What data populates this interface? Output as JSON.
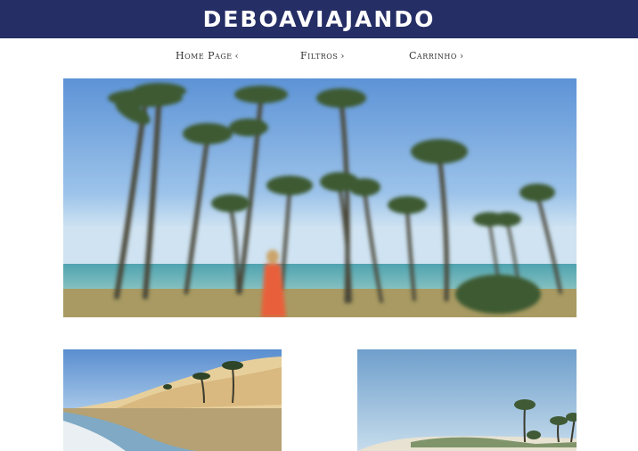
{
  "header": {
    "logo_text": "DEBOAVIAJANDO",
    "background_color": "#262e66"
  },
  "nav": {
    "items": [
      {
        "label": "Home Page",
        "chevron": "‹"
      },
      {
        "label": "Filtros",
        "chevron": "›"
      },
      {
        "label": "Carrinho",
        "chevron": "›"
      }
    ]
  },
  "hero": {
    "image_subject": "blurred beach with palm trees and a woman in red dress"
  },
  "thumbnails": [
    {
      "image_subject": "sand dunes with palm trees beside a lagoon"
    },
    {
      "image_subject": "beach with palm trees under clear sky"
    }
  ]
}
